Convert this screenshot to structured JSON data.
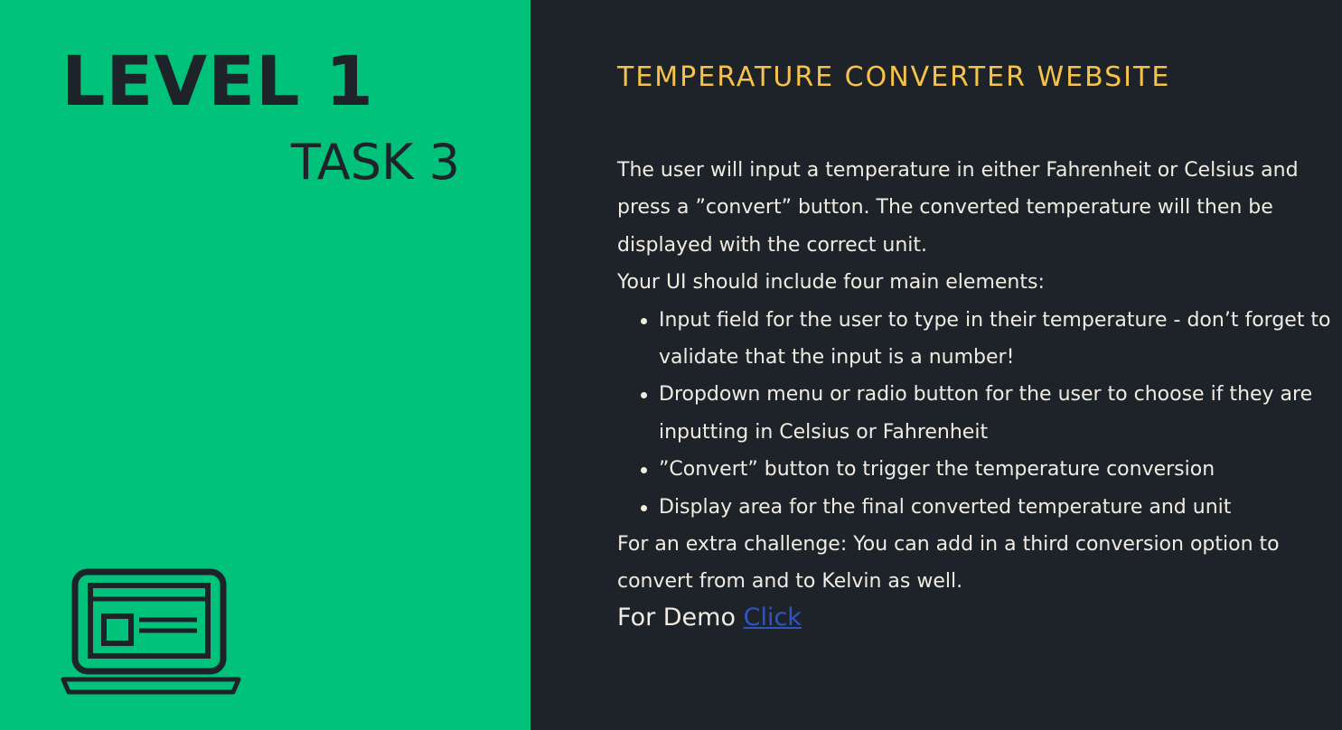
{
  "left": {
    "level": "LEVEL 1",
    "task": "TASK 3",
    "icon": "laptop-icon"
  },
  "colors": {
    "left_background": "#00c27a",
    "right_background": "#1e2329",
    "heading": "#f5c24a",
    "body_text": "#f0ece2",
    "link": "#2f55c4"
  },
  "right": {
    "heading": "TEMPERATURE CONVERTER WEBSITE",
    "intro": "The user will input a temperature in either Fahrenheit or Celsius and press a ”convert” button. The converted temperature will then be displayed with the correct unit.",
    "elements_intro": "Your UI should include four main elements:",
    "bullets": [
      "Input field for the user to type in their temperature - don’t forget to validate that the input is a number!",
      "Dropdown menu or radio button for the user to choose if they are inputting in Celsius or Fahrenheit",
      "”Convert” button to trigger the temperature conversion",
      "Display area for the final converted temperature and unit"
    ],
    "challenge": "For an extra challenge: You can add in a third conversion option to convert from and to Kelvin as well.",
    "demo_label": "For Demo",
    "demo_link": "Click"
  }
}
